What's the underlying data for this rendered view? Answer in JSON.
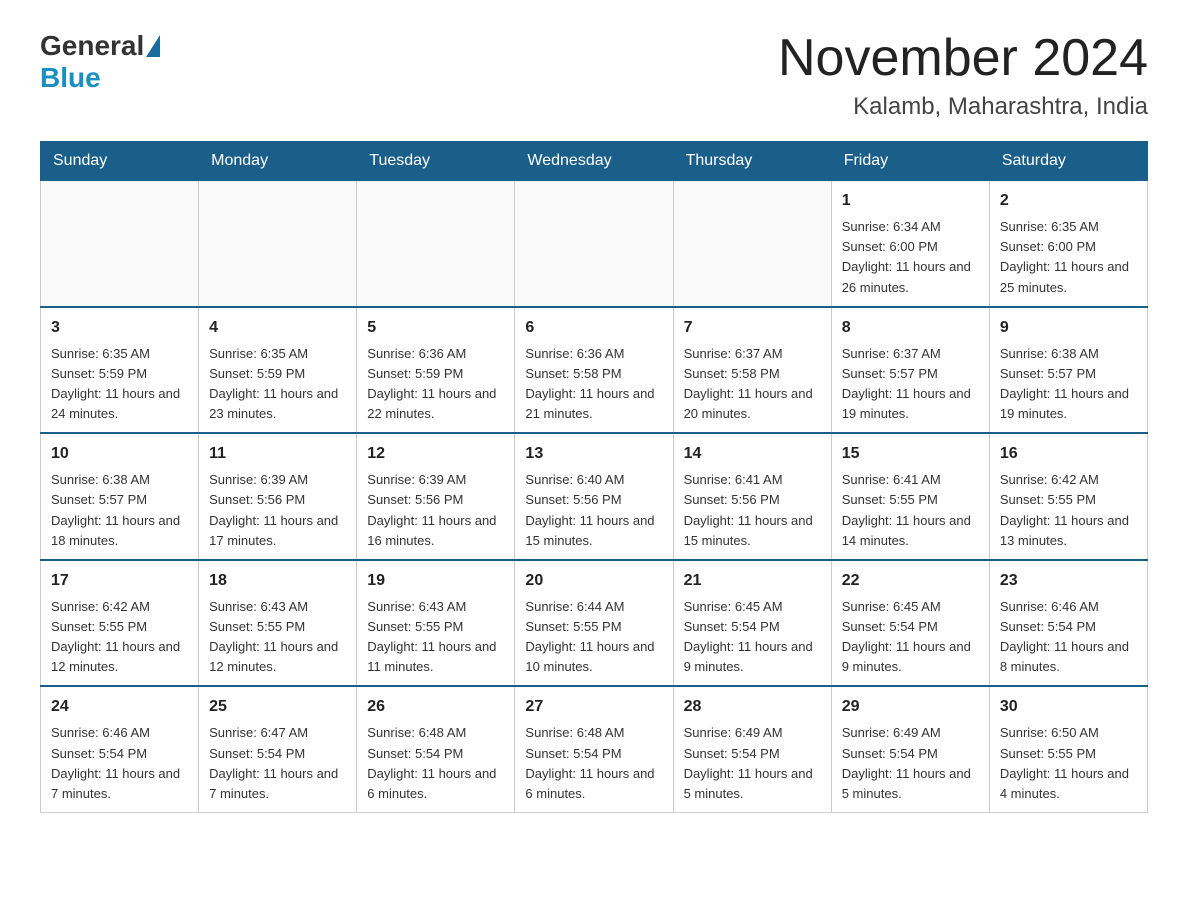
{
  "header": {
    "logo_general": "General",
    "logo_blue": "Blue",
    "title": "November 2024",
    "location": "Kalamb, Maharashtra, India"
  },
  "days_of_week": [
    "Sunday",
    "Monday",
    "Tuesday",
    "Wednesday",
    "Thursday",
    "Friday",
    "Saturday"
  ],
  "weeks": [
    [
      {
        "day": "",
        "info": ""
      },
      {
        "day": "",
        "info": ""
      },
      {
        "day": "",
        "info": ""
      },
      {
        "day": "",
        "info": ""
      },
      {
        "day": "",
        "info": ""
      },
      {
        "day": "1",
        "info": "Sunrise: 6:34 AM\nSunset: 6:00 PM\nDaylight: 11 hours and 26 minutes."
      },
      {
        "day": "2",
        "info": "Sunrise: 6:35 AM\nSunset: 6:00 PM\nDaylight: 11 hours and 25 minutes."
      }
    ],
    [
      {
        "day": "3",
        "info": "Sunrise: 6:35 AM\nSunset: 5:59 PM\nDaylight: 11 hours and 24 minutes."
      },
      {
        "day": "4",
        "info": "Sunrise: 6:35 AM\nSunset: 5:59 PM\nDaylight: 11 hours and 23 minutes."
      },
      {
        "day": "5",
        "info": "Sunrise: 6:36 AM\nSunset: 5:59 PM\nDaylight: 11 hours and 22 minutes."
      },
      {
        "day": "6",
        "info": "Sunrise: 6:36 AM\nSunset: 5:58 PM\nDaylight: 11 hours and 21 minutes."
      },
      {
        "day": "7",
        "info": "Sunrise: 6:37 AM\nSunset: 5:58 PM\nDaylight: 11 hours and 20 minutes."
      },
      {
        "day": "8",
        "info": "Sunrise: 6:37 AM\nSunset: 5:57 PM\nDaylight: 11 hours and 19 minutes."
      },
      {
        "day": "9",
        "info": "Sunrise: 6:38 AM\nSunset: 5:57 PM\nDaylight: 11 hours and 19 minutes."
      }
    ],
    [
      {
        "day": "10",
        "info": "Sunrise: 6:38 AM\nSunset: 5:57 PM\nDaylight: 11 hours and 18 minutes."
      },
      {
        "day": "11",
        "info": "Sunrise: 6:39 AM\nSunset: 5:56 PM\nDaylight: 11 hours and 17 minutes."
      },
      {
        "day": "12",
        "info": "Sunrise: 6:39 AM\nSunset: 5:56 PM\nDaylight: 11 hours and 16 minutes."
      },
      {
        "day": "13",
        "info": "Sunrise: 6:40 AM\nSunset: 5:56 PM\nDaylight: 11 hours and 15 minutes."
      },
      {
        "day": "14",
        "info": "Sunrise: 6:41 AM\nSunset: 5:56 PM\nDaylight: 11 hours and 15 minutes."
      },
      {
        "day": "15",
        "info": "Sunrise: 6:41 AM\nSunset: 5:55 PM\nDaylight: 11 hours and 14 minutes."
      },
      {
        "day": "16",
        "info": "Sunrise: 6:42 AM\nSunset: 5:55 PM\nDaylight: 11 hours and 13 minutes."
      }
    ],
    [
      {
        "day": "17",
        "info": "Sunrise: 6:42 AM\nSunset: 5:55 PM\nDaylight: 11 hours and 12 minutes."
      },
      {
        "day": "18",
        "info": "Sunrise: 6:43 AM\nSunset: 5:55 PM\nDaylight: 11 hours and 12 minutes."
      },
      {
        "day": "19",
        "info": "Sunrise: 6:43 AM\nSunset: 5:55 PM\nDaylight: 11 hours and 11 minutes."
      },
      {
        "day": "20",
        "info": "Sunrise: 6:44 AM\nSunset: 5:55 PM\nDaylight: 11 hours and 10 minutes."
      },
      {
        "day": "21",
        "info": "Sunrise: 6:45 AM\nSunset: 5:54 PM\nDaylight: 11 hours and 9 minutes."
      },
      {
        "day": "22",
        "info": "Sunrise: 6:45 AM\nSunset: 5:54 PM\nDaylight: 11 hours and 9 minutes."
      },
      {
        "day": "23",
        "info": "Sunrise: 6:46 AM\nSunset: 5:54 PM\nDaylight: 11 hours and 8 minutes."
      }
    ],
    [
      {
        "day": "24",
        "info": "Sunrise: 6:46 AM\nSunset: 5:54 PM\nDaylight: 11 hours and 7 minutes."
      },
      {
        "day": "25",
        "info": "Sunrise: 6:47 AM\nSunset: 5:54 PM\nDaylight: 11 hours and 7 minutes."
      },
      {
        "day": "26",
        "info": "Sunrise: 6:48 AM\nSunset: 5:54 PM\nDaylight: 11 hours and 6 minutes."
      },
      {
        "day": "27",
        "info": "Sunrise: 6:48 AM\nSunset: 5:54 PM\nDaylight: 11 hours and 6 minutes."
      },
      {
        "day": "28",
        "info": "Sunrise: 6:49 AM\nSunset: 5:54 PM\nDaylight: 11 hours and 5 minutes."
      },
      {
        "day": "29",
        "info": "Sunrise: 6:49 AM\nSunset: 5:54 PM\nDaylight: 11 hours and 5 minutes."
      },
      {
        "day": "30",
        "info": "Sunrise: 6:50 AM\nSunset: 5:55 PM\nDaylight: 11 hours and 4 minutes."
      }
    ]
  ]
}
